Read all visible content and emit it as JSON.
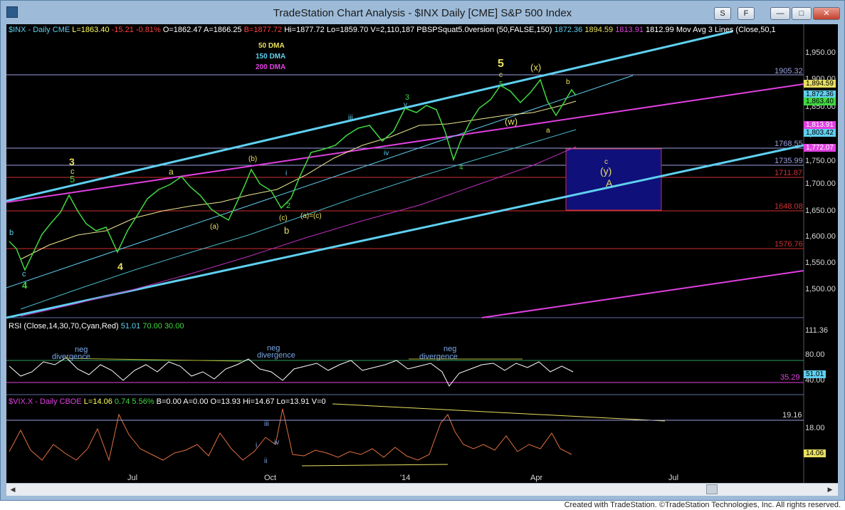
{
  "window": {
    "title": "TradeStation Chart Analysis - $INX Daily [CME] S&P 500 Index"
  },
  "titlebar_buttons": {
    "s_label": "S",
    "f_label": "F"
  },
  "header": {
    "symbol": "$INX - Daily",
    "exchange": "CME",
    "last": "L=1863.40",
    "change": "-15.21",
    "pct": "-0.81%",
    "open_label": "O=1862.47",
    "b_label": "A=1866.25",
    "bid": "B=1877.72",
    "hi": "Hi=1877.72",
    "lo": "Lo=1859.70",
    "vol": "V=2,110,187",
    "indicator": "PBSPSquat5.0version (50,FALSE,150)",
    "v1": "1872.36",
    "v2": "1894.59",
    "v3": "1813.91",
    "v4": "1812.99",
    "mav": "Mov Avg 3 Lines (Close,50,1"
  },
  "legend": {
    "dma50": "50 DMA",
    "dma150": "150 DMA",
    "dma200": "200 DMA"
  },
  "price_axis": {
    "ticks": [
      "1,950.00",
      "1,900.00",
      "1,850.00",
      "1,800.00",
      "1,750.00",
      "1,700.00",
      "1,650.00",
      "1,600.00",
      "1,550.00",
      "1,500.00"
    ],
    "levels": [
      "1905.32",
      "1768.55",
      "1735.99",
      "1711.87",
      "1648.08",
      "1576.76"
    ],
    "tags": [
      "1,894.59",
      "1,872.36",
      "1,863.40",
      "1,813.91",
      "1,803.42",
      "1,772.07"
    ]
  },
  "rsi": {
    "header": "RSI (Close,14,30,70,Cyan,Red)",
    "value": "51.01",
    "ob": "70.00",
    "os": "30.00",
    "axis": [
      "111.36",
      "80.00",
      "40.00"
    ],
    "tag_a": "51.01",
    "tag_b": "35.29",
    "neg": "neg",
    "divergence": "divergence"
  },
  "vix": {
    "header": "$VIX.X - Daily",
    "exchange": "CBOE",
    "last": "L=14.06",
    "change": "0.74",
    "pct": "5.56%",
    "b": "B=0.00",
    "a": "A=0.00",
    "o": "O=13.93",
    "hi": "Hi=14.67",
    "lo": "Lo=13.91",
    "v": "V=0",
    "axis": [
      "19.16",
      "18.00",
      "14.06"
    ]
  },
  "wave_labels": {
    "w3": "3",
    "w4": "4",
    "w5": "5",
    "a": "a",
    "b": "b",
    "c": "c",
    "i": "i",
    "ii": "ii",
    "iii": "iii",
    "iv": "iv",
    "v": "v",
    "b_paren": "(b)",
    "a_paren": "(a)",
    "c_paren": "(c)",
    "aeqc": "(a)=(c)",
    "w": "(w)",
    "x": "(x)",
    "y": "(y)",
    "A": "A",
    "two": "2"
  },
  "time_axis": {
    "labels": [
      "Jul",
      "Oct",
      "'14",
      "Apr",
      "Jul"
    ]
  },
  "footer": {
    "text": "Created with TradeStation. ©TradeStation Technologies, Inc. All rights reserved."
  },
  "colors": {
    "cyan": "#5fd0f0",
    "magenta": "#e040e0",
    "yellow": "#e8e060",
    "green": "#3cd03c",
    "vix": "#e07040",
    "red_line": "#d03030"
  }
}
